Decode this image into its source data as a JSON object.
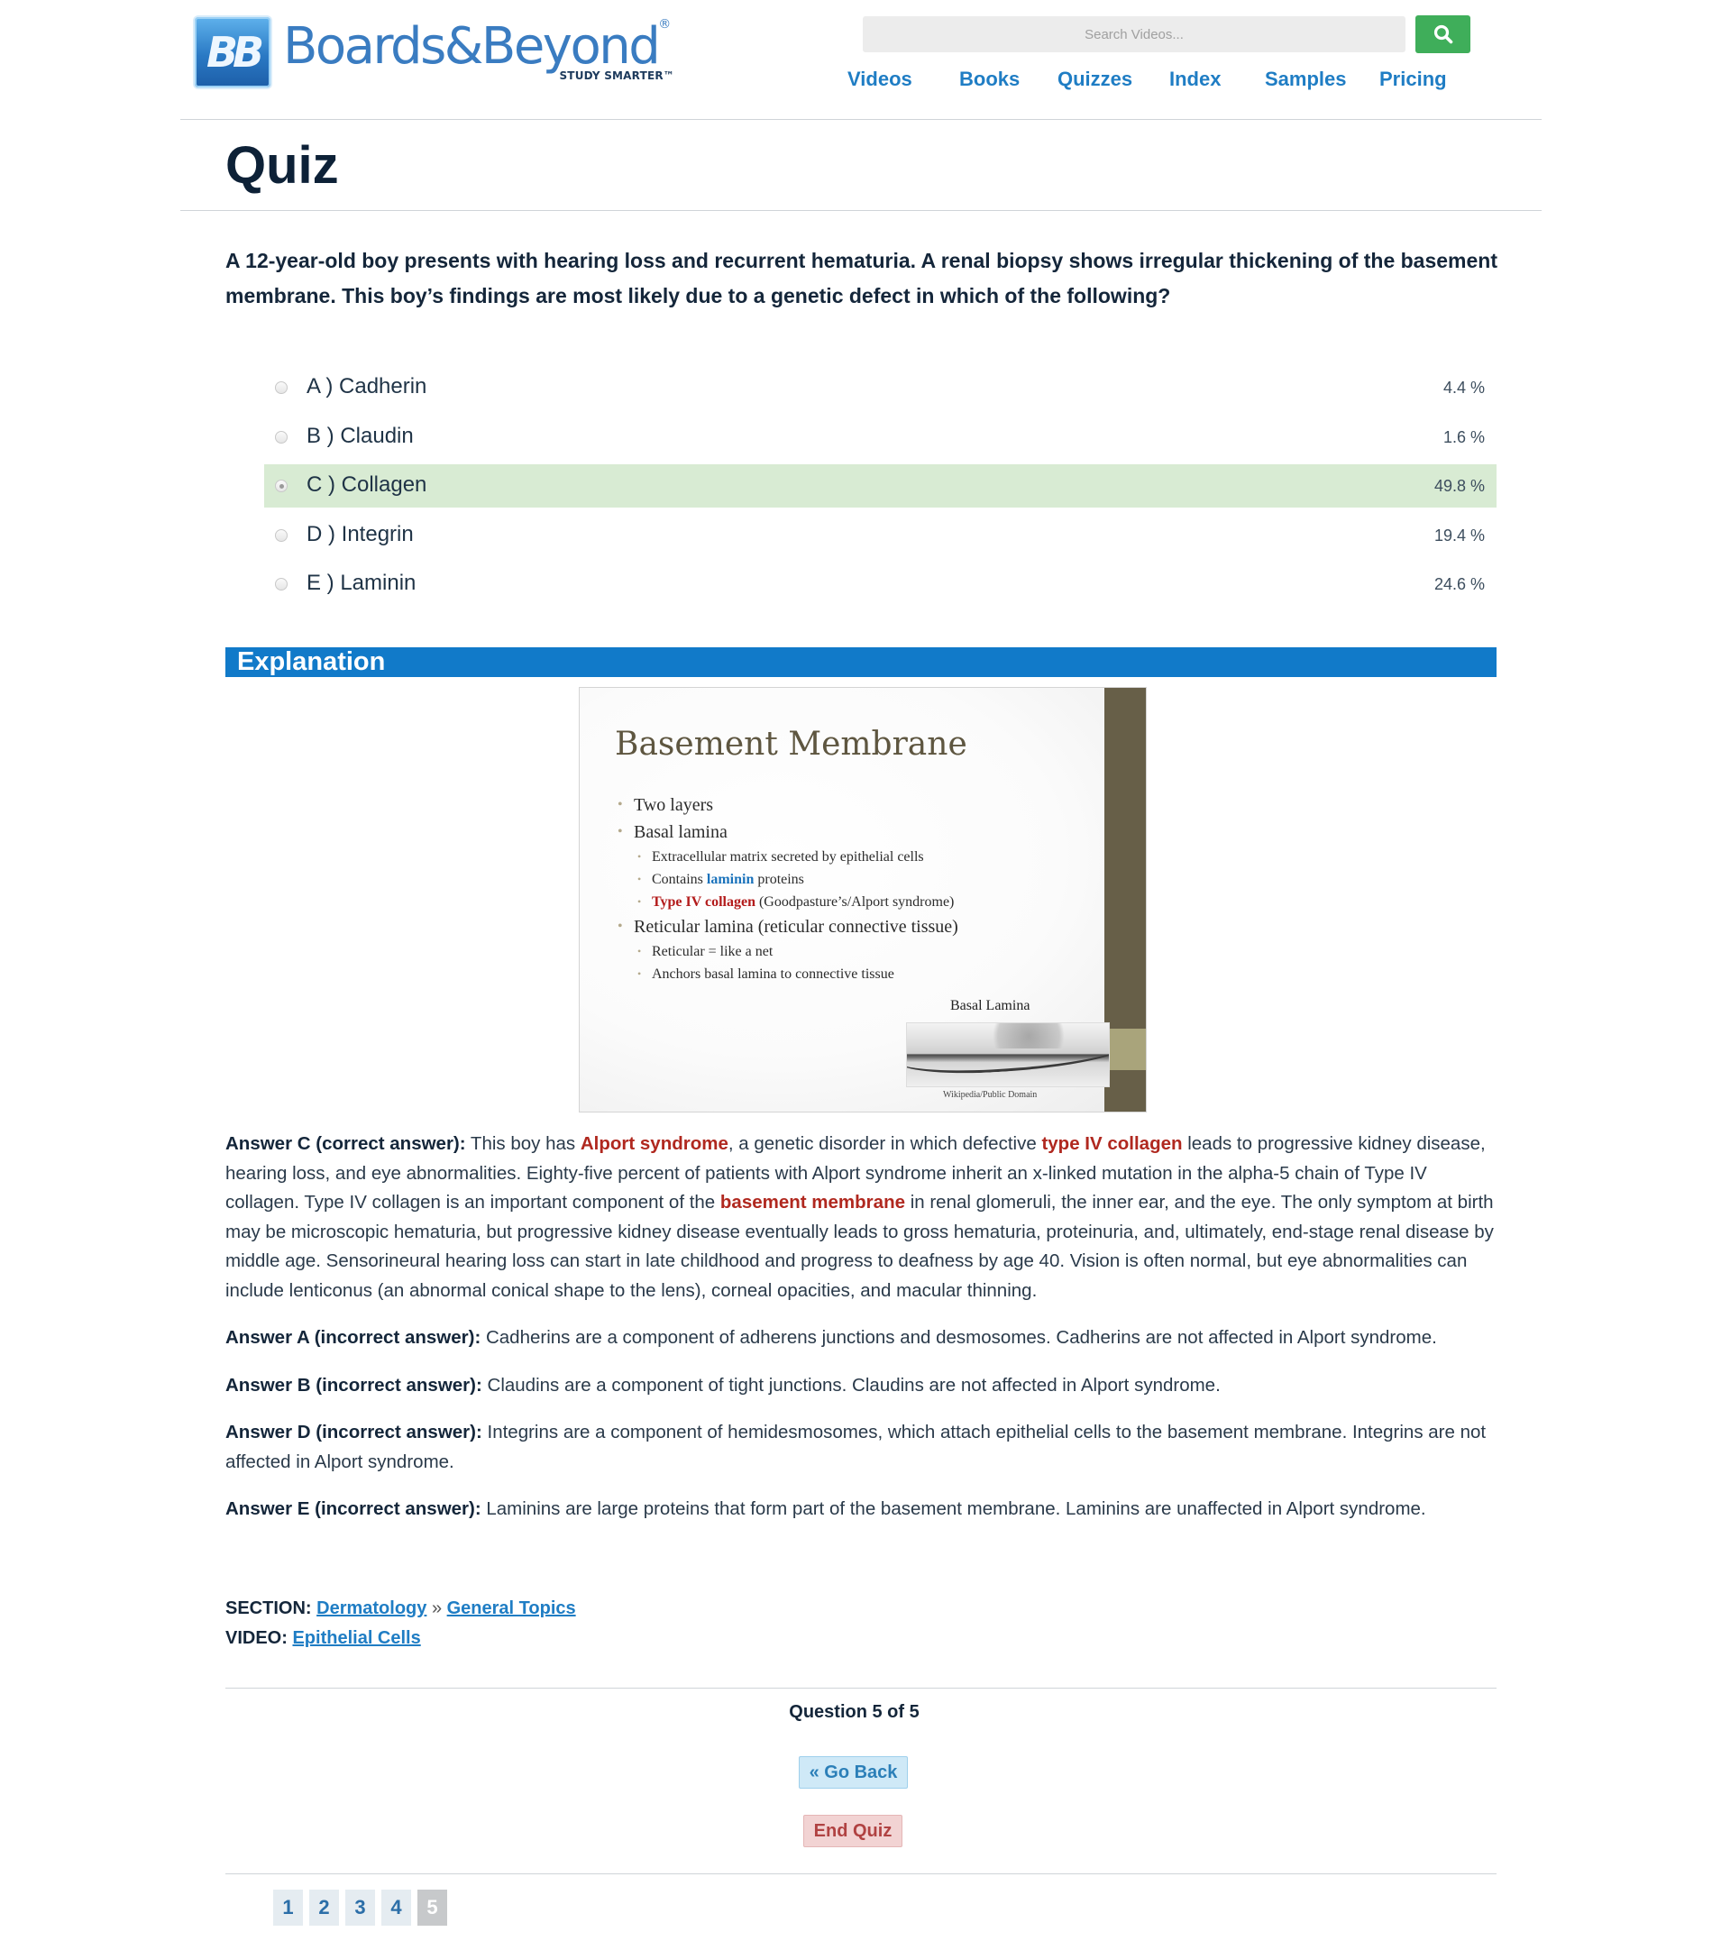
{
  "brand": {
    "logo_mark": "BB",
    "name": "Boards&Beyond",
    "registered": "®",
    "tagline": "STUDY SMARTER™"
  },
  "search": {
    "placeholder": "Search Videos...",
    "button_icon": "search-icon"
  },
  "nav": {
    "items": [
      "Videos",
      "Books",
      "Quizzes",
      "Index",
      "Samples",
      "Pricing"
    ]
  },
  "page": {
    "title": "Quiz"
  },
  "question": {
    "text": "A 12-year-old boy presents with hearing loss and recurrent hematuria. A renal biopsy shows irregular thickening of the basement membrane. This boy’s findings are most likely due to a genetic defect in which of the following?",
    "options": [
      {
        "label": "A ) Cadherin",
        "percent": "4.4 %"
      },
      {
        "label": "B ) Claudin",
        "percent": "1.6 %"
      },
      {
        "label": "C ) Collagen",
        "percent": "49.8 %"
      },
      {
        "label": "D ) Integrin",
        "percent": "19.4 %"
      },
      {
        "label": "E ) Laminin",
        "percent": "24.6 %"
      }
    ],
    "selected": "C ) Collagen",
    "selected_color": "#d8ebd3"
  },
  "explanation": {
    "heading": "Explanation",
    "slide": {
      "title": "Basement Membrane",
      "bullets": {
        "b1": "Two layers",
        "b2": "Basal lamina",
        "b2_s1": "Extracellular matrix secreted by epithelial cells",
        "b2_s2_pre": "Contains ",
        "b2_s2_hl": "laminin",
        "b2_s2_post": " proteins",
        "b2_s3_hl": "Type IV collagen",
        "b2_s3_post": " (Goodpasture’s/Alport syndrome)",
        "b3": "Reticular lamina (reticular connective tissue)",
        "b3_s1": "Reticular = like a net",
        "b3_s2": "Anchors basal lamina to connective tissue"
      },
      "image_caption": "Basal Lamina",
      "image_credit": "Wikipedia/Public Domain"
    },
    "answer_c": {
      "lead": "Answer C (correct answer):",
      "t1": " This boy has ",
      "h1": "Alport syndrome",
      "t2": ", a genetic disorder in which defective ",
      "h2": "type IV collagen",
      "t3": " leads to progressive kidney disease, hearing loss, and eye abnormalities. Eighty-five percent of patients with Alport syndrome inherit an x-linked mutation in the alpha-5 chain of Type IV collagen. Type IV collagen is an important component of the ",
      "h3": "basement membrane",
      "t4": " in renal glomeruli, the inner ear, and the eye. The only symptom at birth may be microscopic hematuria, but progressive kidney disease eventually leads to gross hematuria, proteinuria, and, ultimately, end-stage renal disease by middle age. Sensorineural hearing loss can start in late childhood and progress to deafness by age 40. Vision is often normal, but eye abnormalities can include lenticonus (an abnormal conical shape to the lens), corneal opacities, and macular thinning."
    },
    "answer_a": {
      "lead": "Answer A (incorrect answer):",
      "text": " Cadherins are a component of adherens junctions and desmosomes. Cadherins are not affected in Alport syndrome."
    },
    "answer_b": {
      "lead": "Answer B (incorrect answer):",
      "text": " Claudins are a component of tight junctions. Claudins are not affected in Alport syndrome."
    },
    "answer_d": {
      "lead": "Answer D (incorrect answer):",
      "text": " Integrins are a component of hemidesmosomes, which attach epithelial cells to the basement membrane. Integrins are not affected in Alport syndrome."
    },
    "answer_e": {
      "lead": "Answer E (incorrect answer):",
      "text": " Laminins are large proteins that form part of the basement membrane. Laminins are unaffected in Alport syndrome."
    }
  },
  "meta": {
    "section_label": "SECTION:",
    "section_link": "Dermatology",
    "separator": "»",
    "topic_link": "General Topics",
    "video_label": "VIDEO:",
    "video_link": "Epithelial Cells"
  },
  "footer": {
    "question_count": "Question 5 of 5",
    "go_back": "« Go Back",
    "end_quiz": "End Quiz",
    "pages": [
      "1",
      "2",
      "3",
      "4",
      "5"
    ],
    "current_page": "5"
  },
  "colors": {
    "brand_blue": "#1f7dc4",
    "explanation_bar": "#117ac9",
    "highlight_red": "#b0281f",
    "search_button": "#3fae5a"
  }
}
